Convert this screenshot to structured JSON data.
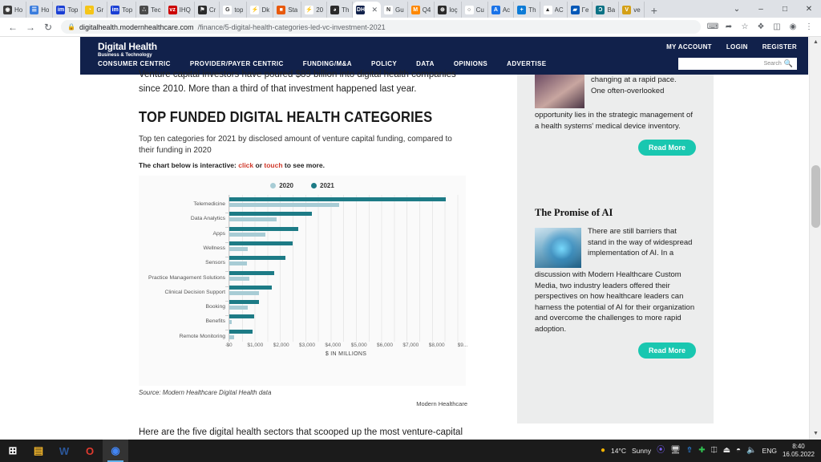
{
  "browser": {
    "tabs": [
      {
        "title": "Ho",
        "icon": "chrome-icon",
        "color": "#3b3b3b",
        "glyph": "◉",
        "active": false
      },
      {
        "title": "Ho",
        "icon": "document-icon",
        "color": "#3b7ddd",
        "glyph": "☰",
        "active": false
      },
      {
        "title": "Top",
        "icon": "im-icon",
        "color": "#1a3fd4",
        "glyph": "im",
        "active": false
      },
      {
        "title": "Gr",
        "icon": "opera-icon",
        "color": "#f5c518",
        "glyph": "◔",
        "active": false
      },
      {
        "title": "Top",
        "icon": "im-icon",
        "color": "#1a3fd4",
        "glyph": "im",
        "active": false
      },
      {
        "title": "Tec",
        "icon": "cluster-icon",
        "color": "#4a4a4a",
        "glyph": "∴",
        "active": false
      },
      {
        "title": "IHQ",
        "icon": "vz-icon",
        "color": "#cc0000",
        "glyph": "vz",
        "active": false
      },
      {
        "title": "Cr",
        "icon": "flag-icon",
        "color": "#2b2b2b",
        "glyph": "⚑",
        "active": false
      },
      {
        "title": "top",
        "icon": "google-icon",
        "color": "#ffffff",
        "glyph": "G",
        "active": false
      },
      {
        "title": "Dk",
        "icon": "lightning-icon",
        "color": "#ffffff",
        "glyph": "⚡",
        "active": false
      },
      {
        "title": "Sta",
        "icon": "squares-icon",
        "color": "#e8590c",
        "glyph": "■",
        "active": false
      },
      {
        "title": "20",
        "icon": "lightning-icon",
        "color": "#ffffff",
        "glyph": "⚡",
        "active": false
      },
      {
        "title": "Th",
        "icon": "spiral-icon",
        "color": "#2b2b2b",
        "glyph": "◕",
        "active": false
      },
      {
        "title": "",
        "icon": "dh-icon",
        "color": "#11214b",
        "glyph": "DH",
        "active": true
      },
      {
        "title": "Gu",
        "icon": "n-icon",
        "color": "#ffffff",
        "glyph": "N",
        "active": false
      },
      {
        "title": "Q4",
        "icon": "m-icon",
        "color": "#ff8800",
        "glyph": "M",
        "active": false
      },
      {
        "title": "loç",
        "icon": "globe-icon",
        "color": "#2b2b2b",
        "glyph": "⊕",
        "active": false
      },
      {
        "title": "Cu",
        "icon": "ring-icon",
        "color": "#ffffff",
        "glyph": "○",
        "active": false
      },
      {
        "title": "Ac",
        "icon": "a-icon",
        "color": "#1a73e8",
        "glyph": "A",
        "active": false
      },
      {
        "title": "Th",
        "icon": "plus-circle-icon",
        "color": "#0d7bd6",
        "glyph": "+",
        "active": false
      },
      {
        "title": "AC",
        "icon": "triangle-icon",
        "color": "#ffffff",
        "glyph": "▲",
        "active": false
      },
      {
        "title": "Гe",
        "icon": "ukraine-icon",
        "color": "#0057b7",
        "glyph": "▰",
        "active": false
      },
      {
        "title": "Ba",
        "icon": "c-icon",
        "color": "#0b7285",
        "glyph": "Ɔ",
        "active": false
      },
      {
        "title": "ve",
        "icon": "v-icon",
        "color": "#d4a017",
        "glyph": "V",
        "active": false
      }
    ],
    "new_tab_label": "+",
    "window_controls": {
      "menu": "⌄",
      "minimize": "–",
      "maximize": "□",
      "close": "✕"
    },
    "nav": {
      "back": "←",
      "forward": "→",
      "reload": "↻"
    },
    "omnibox": {
      "lock_icon": "lock-icon",
      "host": "digitalhealth.modernhealthcare.com",
      "path": "/finance/5-digital-health-categories-led-vc-investment-2021"
    },
    "toolbar_icons": [
      "translate-icon",
      "share-icon",
      "bookmark-star-icon",
      "extensions-icon",
      "sidepanel-icon",
      "profile-icon",
      "menu-kebab-icon"
    ]
  },
  "site": {
    "logo_line1": "Digital Health",
    "logo_line2": "Business & Technology",
    "top_nav": [
      "MY ACCOUNT",
      "LOGIN",
      "REGISTER"
    ],
    "main_nav": [
      "CONSUMER CENTRIC",
      "PROVIDER/PAYER CENTRIC",
      "FUNDING/M&A",
      "POLICY",
      "DATA",
      "OPINIONS",
      "ADVERTISE"
    ],
    "search": {
      "placeholder": "Search",
      "icon": "search-icon"
    }
  },
  "article": {
    "lede_clipped": "Venture capital investors have poured $89 billion into digital health companies",
    "lede": "since 2010. More than a third of that investment happened last year.",
    "section_heading": "TOP FUNDED DIGITAL HEALTH CATEGORIES",
    "deck": "Top ten categories for 2021 by disclosed amount of venture capital funding, compared to their funding in 2020",
    "interactive_pre": "The chart below is interactive: ",
    "interactive_click": "click",
    "interactive_mid": " or ",
    "interactive_touch": "touch",
    "interactive_post": " to see more.",
    "source": "Source: Modern Healthcare Digital Health data",
    "credit": "Modern Healthcare",
    "tail": "Here are the five digital health sectors that scooped up the most venture-capital"
  },
  "chart_data": {
    "type": "bar",
    "orientation": "horizontal",
    "title": "TOP FUNDED DIGITAL HEALTH CATEGORIES",
    "xlabel": "$ IN MILLIONS",
    "ylabel": "",
    "xlim": [
      0,
      9000
    ],
    "xticks": [
      0,
      1000,
      2000,
      3000,
      4000,
      5000,
      6000,
      7000,
      8000,
      9000
    ],
    "xtick_labels": [
      "$0",
      "$1,000",
      "$2,000",
      "$3,000",
      "$4,000",
      "$5,000",
      "$6,000",
      "$7,000",
      "$8,000",
      "$9..."
    ],
    "grid": true,
    "legend_position": "top-center",
    "categories": [
      "Telemedicine",
      "Data Analytics",
      "Apps",
      "Wellness",
      "Sensors",
      "Practice Management Solutions",
      "Clinical Decision Support",
      "Booking",
      "Benefits",
      "Remote Monitoring"
    ],
    "series": [
      {
        "name": "2021",
        "color": "#1d7b86",
        "values": [
          8350,
          3200,
          2670,
          2430,
          2170,
          1720,
          1630,
          1140,
          960,
          900
        ]
      },
      {
        "name": "2020",
        "color": "#a8ccd5",
        "values": [
          4250,
          1830,
          1380,
          700,
          680,
          760,
          1130,
          700,
          80,
          180
        ]
      }
    ]
  },
  "sidebar": {
    "promo1": {
      "image": "woman-portrait-image",
      "body_clipped": "changing at a rapid pace.",
      "body_line2": "One often-overlooked",
      "body": "opportunity lies in the strategic management of a health systems' medical device inventory.",
      "cta": "Read More"
    },
    "promo2": {
      "heading": "The Promise of AI",
      "image": "ai-hologram-image",
      "body_indented": "There are still barriers that stand in the way of widespread implementation of AI. In a",
      "body": "discussion with Modern Healthcare Custom Media, two industry leaders offered their perspectives on how healthcare leaders can harness the potential of AI for their organization and overcome the challenges to more rapid adoption.",
      "cta": "Read More"
    }
  },
  "scrollbar": {
    "up": "▲",
    "down": "▼"
  },
  "taskbar": {
    "apps": [
      {
        "name": "start-button",
        "glyph": "⊞",
        "color": "#ffffff",
        "active": false
      },
      {
        "name": "file-explorer",
        "glyph": "▤",
        "color": "#f0b429",
        "active": false
      },
      {
        "name": "word",
        "glyph": "W",
        "color": "#2b579a",
        "active": false
      },
      {
        "name": "opera",
        "glyph": "O",
        "color": "#e03b2f",
        "active": false
      },
      {
        "name": "chrome",
        "glyph": "◉",
        "color": "#4285f4",
        "active": true
      }
    ],
    "weather": {
      "icon": "sun-icon",
      "temp": "14°C",
      "condition": "Sunny"
    },
    "tray_icons": [
      "defender-icon",
      "network-icon",
      "bluetooth-icon",
      "update-icon",
      "monitor-icon",
      "usb-icon",
      "wifi-icon",
      "volume-icon"
    ],
    "language": "ENG",
    "time": "8:40",
    "date": "16.05.2022"
  }
}
